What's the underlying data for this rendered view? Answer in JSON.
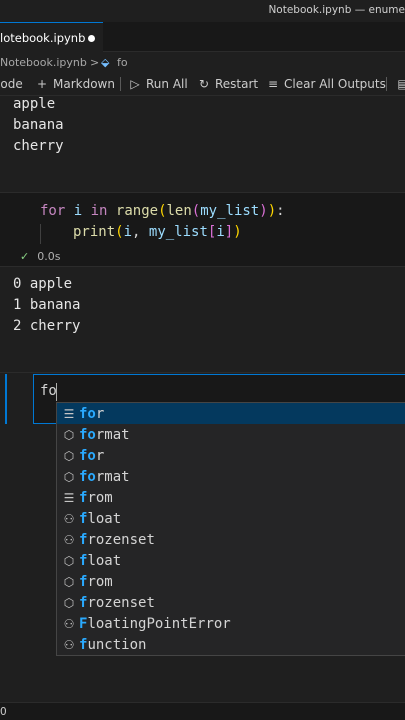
{
  "window": {
    "title": "Notebook.ipynb — enume"
  },
  "tab": {
    "label": "lotebook.ipynb"
  },
  "breadcrumb": {
    "file": "Notebook.ipynb",
    "separator": ">",
    "symbol": "fo"
  },
  "toolbar": {
    "code_label": "Code",
    "markdown_label": "Markdown",
    "run_all_label": "Run All",
    "restart_label": "Restart",
    "clear_outputs_label": "Clear All Outputs"
  },
  "output1": {
    "lines": [
      "apple",
      "banana",
      "cherry"
    ]
  },
  "cell2": {
    "line1": {
      "kw": "for",
      "var": "i",
      "kw2": "in",
      "fn": "range",
      "fn2": "len",
      "arg": "my_list"
    },
    "line2": {
      "fn": "print",
      "var1": "i",
      "var2": "my_list",
      "var3": "i"
    },
    "exec_time": "0.0s"
  },
  "output2": {
    "lines": [
      "0 apple",
      "1 banana",
      "2 cherry"
    ]
  },
  "active_cell": {
    "typed": "fo"
  },
  "suggestions": [
    {
      "match": "fo",
      "rest": "r",
      "icon": "keyword-icon"
    },
    {
      "match": "fo",
      "rest": "rmat",
      "icon": "module-icon"
    },
    {
      "match": "fo",
      "rest": "r",
      "icon": "module-icon"
    },
    {
      "match": "fo",
      "rest": "rmat",
      "icon": "module-icon"
    },
    {
      "match": "f",
      "rest": "rom",
      "icon": "keyword-icon"
    },
    {
      "match": "f",
      "rest": "loat",
      "icon": "class-icon"
    },
    {
      "match": "f",
      "rest": "rozenset",
      "icon": "class-icon"
    },
    {
      "match": "f",
      "rest": "loat",
      "icon": "module-icon"
    },
    {
      "match": "f",
      "rest": "rom",
      "icon": "module-icon"
    },
    {
      "match": "f",
      "rest": "rozenset",
      "icon": "module-icon"
    },
    {
      "match": "F",
      "rest": "loatingPointError",
      "icon": "class-icon"
    },
    {
      "match": "f",
      "rest": "unction",
      "icon": "class-icon"
    }
  ],
  "status": {
    "text": "0"
  }
}
